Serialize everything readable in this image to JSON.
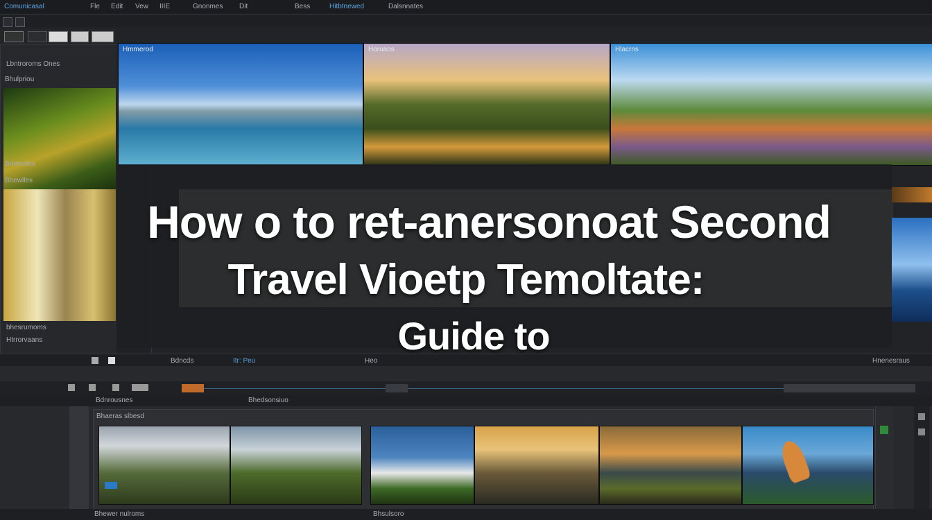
{
  "app": {
    "title": "Comunicasal"
  },
  "menubar": {
    "items": [
      "Fle",
      "Edit",
      "Vew",
      "IIIE",
      "Gnonmes",
      "Dit",
      "Bess",
      "Hitbtnewed",
      "Dalsnnates"
    ]
  },
  "project_panel": {
    "header": "Lbntroroms Ones",
    "section1_label": "Bhulpriou",
    "section2_label": "Bmensles",
    "section3_label": "Bhewlles",
    "footer_labels": [
      "bhesrumoms",
      "Htrrorvaans"
    ]
  },
  "preview": {
    "labels": [
      "Hmmerod",
      "Horuaos",
      "Hlacrns"
    ]
  },
  "overlay_title": {
    "line1": "How o to ret-anersonoat Second",
    "line2": "Travel Vioetp Temoltate:",
    "line3": "Guide to"
  },
  "transport": {
    "labels": [
      "Bdncds",
      "Itr: Peu",
      "Heo"
    ],
    "right_label": "Hnenesraus"
  },
  "timeline": {
    "header_left": "Bdnrousnes",
    "header_mid": "Bhedsonsiuo",
    "track_label": "Bhaeras slbesd",
    "footer_left": "Bhewer nulroms",
    "footer_mid": "Bhsulsoro"
  },
  "colors": {
    "accent": "#5aa3e0",
    "bg": "#222326",
    "panel": "#26282c",
    "clip_orange": "#c06a2c"
  }
}
